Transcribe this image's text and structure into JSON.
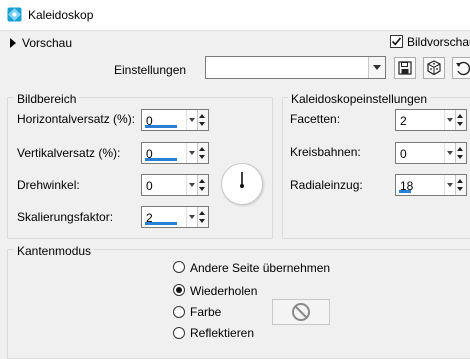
{
  "window": {
    "title": "Kaleidoskop",
    "accent": "#1a9fd4"
  },
  "preview": {
    "toggle_label": "Vorschau",
    "bildvorschau_label": "Bildvorschau",
    "bildvorschau_checked": true
  },
  "settings": {
    "label": "Einstellungen",
    "value": ""
  },
  "bildbereich": {
    "title": "Bildbereich",
    "horizontal": {
      "label": "Horizontalversatz (%):",
      "value": "0"
    },
    "vertikal": {
      "label": "Vertikalversatz (%):",
      "value": "0"
    },
    "drehwinkel": {
      "label": "Drehwinkel:",
      "value": "0"
    },
    "skalierung": {
      "label": "Skalierungsfaktor:",
      "value": "2"
    }
  },
  "kaleido": {
    "title": "Kaleidoskopeinstellungen",
    "facetten": {
      "label": "Facetten:",
      "value": "2"
    },
    "kreisbahnen": {
      "label": "Kreisbahnen:",
      "value": "0"
    },
    "radialeinzug": {
      "label": "Radialeinzug:",
      "value": "18"
    }
  },
  "kanten": {
    "title": "Kantenmodus",
    "options": [
      "Andere Seite übernehmen",
      "Wiederholen",
      "Farbe",
      "Reflektieren"
    ],
    "selected": "Wiederholen"
  }
}
